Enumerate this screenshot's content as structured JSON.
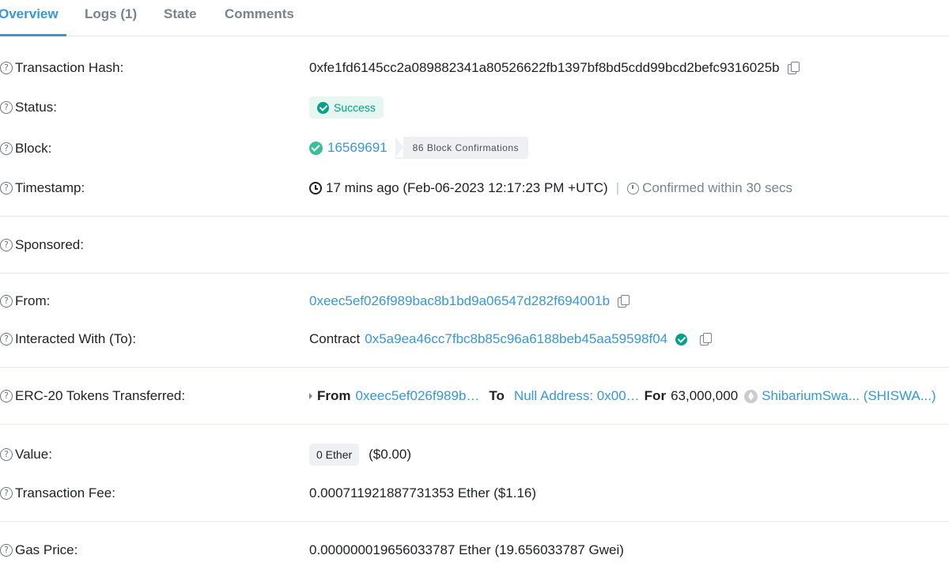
{
  "tabs": [
    {
      "label": "Overview",
      "active": true
    },
    {
      "label": "Logs (1)",
      "active": false
    },
    {
      "label": "State",
      "active": false
    },
    {
      "label": "Comments",
      "active": false
    }
  ],
  "rows": {
    "tx_hash": {
      "label": "Transaction Hash:",
      "value": "0xfe1fd6145cc2a089882341a80526622fb1397bf8bd5cdd99bcd2befc9316025b"
    },
    "status": {
      "label": "Status:",
      "value": "Success"
    },
    "block": {
      "label": "Block:",
      "value": "16569691",
      "confirmations": "86 Block Confirmations"
    },
    "timestamp": {
      "label": "Timestamp:",
      "value": "17 mins ago (Feb-06-2023 12:17:23 PM +UTC)",
      "separator": "|",
      "confirmed": "Confirmed within 30 secs"
    },
    "sponsored": {
      "label": "Sponsored:"
    },
    "from": {
      "label": "From:",
      "value": "0xeec5ef026f989bac8b1bd9a06547d282f694001b"
    },
    "to": {
      "label": "Interacted With (To):",
      "prefix": "Contract",
      "value": "0x5a9ea46cc7fbc8b85c96a6188beb45aa59598f04"
    },
    "erc20": {
      "label": "ERC-20 Tokens Transferred:",
      "from_label": "From",
      "from_value": "0xeec5ef026f989b…",
      "to_label": "To",
      "to_value": "Null Address: 0x00…",
      "for_label": "For",
      "amount": "63,000,000",
      "token": "ShibariumSwa... (SHISWA...)"
    },
    "value": {
      "label": "Value:",
      "amount": "0 Ether",
      "usd": "($0.00)"
    },
    "fee": {
      "label": "Transaction Fee:",
      "value": "0.000711921887731353 Ether ($1.16)"
    },
    "gas": {
      "label": "Gas Price:",
      "value": "0.000000019656033787 Ether (19.656033787 Gwei)"
    }
  },
  "colors": {
    "accent": "#3498db",
    "success": "#00a186",
    "muted": "#77838f",
    "divider": "#e7eaf3"
  },
  "icons": [
    "question-icon",
    "copy-icon",
    "check-circle-icon",
    "clock-icon",
    "timer-icon",
    "caret-right-icon",
    "ether-token-icon"
  ]
}
